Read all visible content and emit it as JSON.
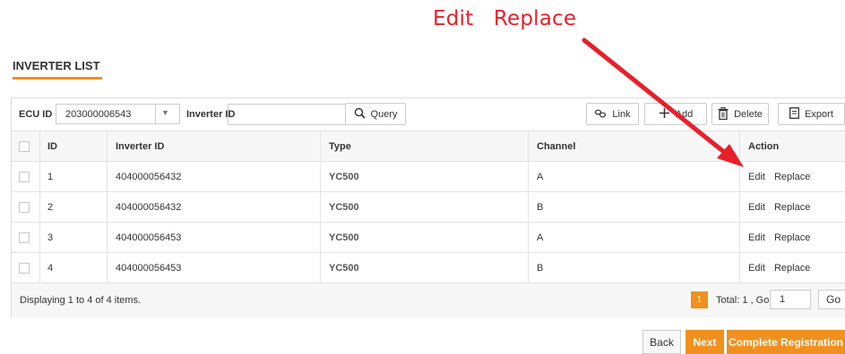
{
  "annotation": {
    "text": "Edit   Replace",
    "color": "#e8202a"
  },
  "page": {
    "title": "INVERTER LIST",
    "accent": "#f0901e"
  },
  "toolbar": {
    "ecu_label": "ECU ID",
    "ecu_value": "203000006543",
    "inverter_label": "Inverter ID",
    "inverter_value": "",
    "query_label": "Query",
    "link_label": "Link",
    "add_label": "Add",
    "delete_label": "Delete",
    "export_label": "Export"
  },
  "table": {
    "headers": {
      "id": "ID",
      "inverter_id": "Inverter ID",
      "type": "Type",
      "channel": "Channel",
      "action": "Action"
    },
    "rows": [
      {
        "id": "1",
        "inverter_id": "404000056432",
        "type": "YC500",
        "channel": "A",
        "edit": "Edit",
        "replace": "Replace"
      },
      {
        "id": "2",
        "inverter_id": "404000056432",
        "type": "YC500",
        "channel": "B",
        "edit": "Edit",
        "replace": "Replace"
      },
      {
        "id": "3",
        "inverter_id": "404000056453",
        "type": "YC500",
        "channel": "A",
        "edit": "Edit",
        "replace": "Replace"
      },
      {
        "id": "4",
        "inverter_id": "404000056453",
        "type": "YC500",
        "channel": "B",
        "edit": "Edit",
        "replace": "Replace"
      }
    ]
  },
  "pagination": {
    "display_text": "Displaying 1 to 4 of 4 items.",
    "current_page": "1",
    "total_text": "Total: 1 , Go to",
    "goto_value": "1",
    "go_label": "Go"
  },
  "actions": {
    "back_label": "Back",
    "next_label": "Next",
    "complete_label": "Complete Registration"
  }
}
